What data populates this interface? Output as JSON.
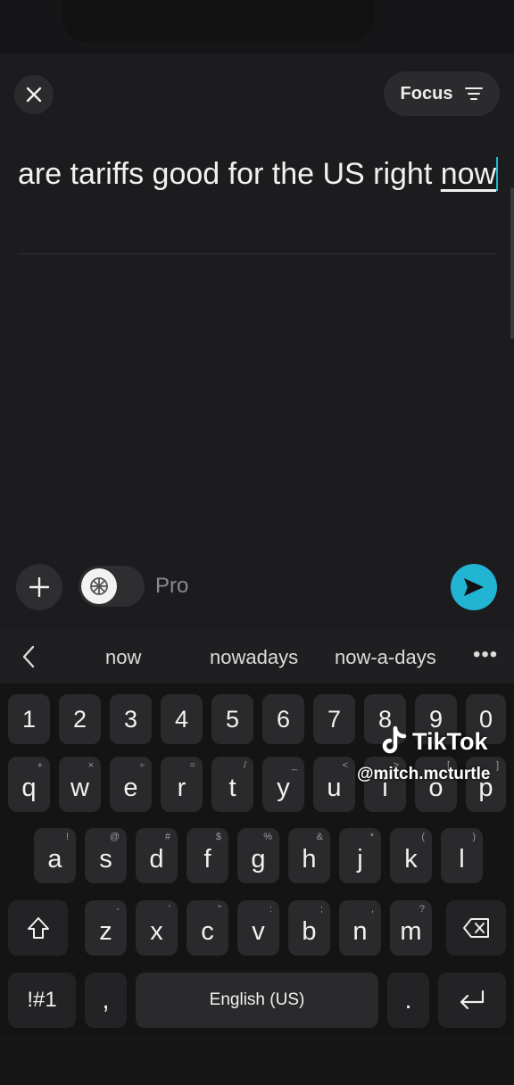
{
  "header": {
    "focus_label": "Focus"
  },
  "query": {
    "text_before": "are tariffs good for the US right ",
    "current_word": "now"
  },
  "composer": {
    "pro_label": "Pro"
  },
  "suggestions": [
    "now",
    "nowadays",
    "now-a-days"
  ],
  "keyboard": {
    "numbers": [
      "1",
      "2",
      "3",
      "4",
      "5",
      "6",
      "7",
      "8",
      "9",
      "0"
    ],
    "row1": [
      {
        "k": "q",
        "s": "+"
      },
      {
        "k": "w",
        "s": "×"
      },
      {
        "k": "e",
        "s": "÷"
      },
      {
        "k": "r",
        "s": "="
      },
      {
        "k": "t",
        "s": "/"
      },
      {
        "k": "y",
        "s": "_"
      },
      {
        "k": "u",
        "s": "<"
      },
      {
        "k": "i",
        "s": ">"
      },
      {
        "k": "o",
        "s": "["
      },
      {
        "k": "p",
        "s": "]"
      }
    ],
    "row2": [
      {
        "k": "a",
        "s": "!"
      },
      {
        "k": "s",
        "s": "@"
      },
      {
        "k": "d",
        "s": "#"
      },
      {
        "k": "f",
        "s": "$"
      },
      {
        "k": "g",
        "s": "%"
      },
      {
        "k": "h",
        "s": "&"
      },
      {
        "k": "j",
        "s": "*"
      },
      {
        "k": "k",
        "s": "("
      },
      {
        "k": "l",
        "s": ")"
      }
    ],
    "row3": [
      {
        "k": "z",
        "s": "-"
      },
      {
        "k": "x",
        "s": "'"
      },
      {
        "k": "c",
        "s": "\""
      },
      {
        "k": "v",
        "s": ":"
      },
      {
        "k": "b",
        "s": ";"
      },
      {
        "k": "n",
        "s": ","
      },
      {
        "k": "m",
        "s": "?"
      }
    ],
    "symbols_label": "!#1",
    "comma_label": ",",
    "space_label": "English (US)",
    "period_label": "."
  },
  "watermark": {
    "brand": "TikTok",
    "handle": "@mitch.mcturtle"
  },
  "colors": {
    "accent": "#22b4d3",
    "background": "#1c1c1e"
  }
}
